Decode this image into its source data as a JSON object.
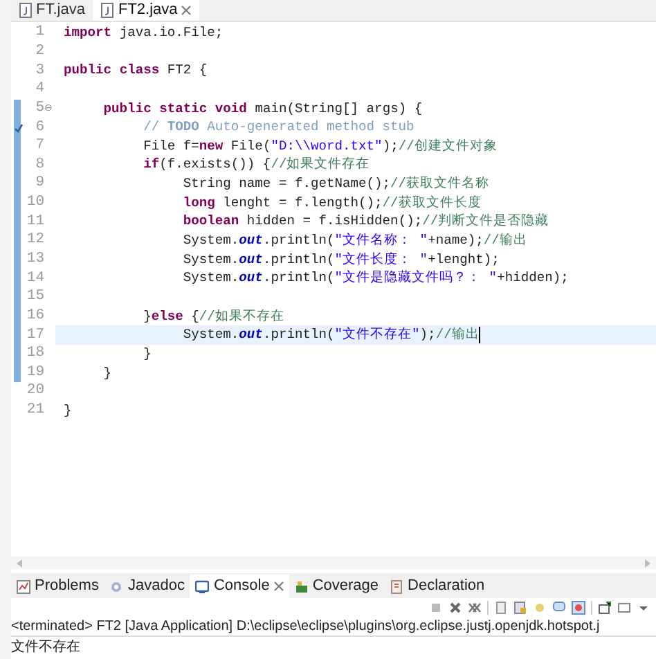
{
  "editor_tabs": [
    {
      "label": "FT.java",
      "selected": false
    },
    {
      "label": "FT2.java",
      "selected": true
    }
  ],
  "code_lines": [
    {
      "number": "1",
      "current": false,
      "tokens": [
        {
          "kind": "keyword",
          "text": "import "
        },
        {
          "kind": "plain",
          "text": "java.io.File;"
        }
      ]
    },
    {
      "number": "2",
      "current": false
    },
    {
      "number": "3",
      "current": false,
      "tokens": [
        {
          "kind": "keyword",
          "text": "public "
        },
        {
          "kind": "keyword",
          "text": "class "
        },
        {
          "kind": "plain",
          "text": "FT2 {"
        }
      ]
    },
    {
      "number": "4",
      "current": false
    },
    {
      "number": "5",
      "current": false,
      "fold": "⊖",
      "tokens": [
        {
          "kind": "keyword",
          "text": "     public "
        },
        {
          "kind": "keyword",
          "text": "static "
        },
        {
          "kind": "keyword",
          "text": "void "
        },
        {
          "kind": "plain",
          "text": "main(String[] args) {"
        }
      ]
    },
    {
      "number": "6",
      "current": false,
      "task_marker": true,
      "tokens": [
        {
          "kind": "javadoc",
          "text": "          // "
        },
        {
          "kind": "todo",
          "text": "TODO"
        },
        {
          "kind": "javadoc",
          "text": " Auto-generated method stub"
        }
      ]
    },
    {
      "number": "7",
      "current": false,
      "tokens": [
        {
          "kind": "plain",
          "text": "          File f="
        },
        {
          "kind": "keyword",
          "text": "new"
        },
        {
          "kind": "plain",
          "text": " File("
        },
        {
          "kind": "string",
          "text": "\"D:\\\\word.txt\""
        },
        {
          "kind": "plain",
          "text": ");"
        },
        {
          "kind": "comment",
          "text": "//创建文件对象"
        }
      ]
    },
    {
      "number": "8",
      "current": false,
      "tokens": [
        {
          "kind": "keyword",
          "text": "          if"
        },
        {
          "kind": "plain",
          "text": "(f.exists()) {"
        },
        {
          "kind": "comment",
          "text": "//如果文件存在"
        }
      ]
    },
    {
      "number": "9",
      "current": false,
      "tokens": [
        {
          "kind": "plain",
          "text": "               String name = f.getName();"
        },
        {
          "kind": "comment",
          "text": "//获取文件名称"
        }
      ]
    },
    {
      "number": "10",
      "current": false,
      "tokens": [
        {
          "kind": "keyword",
          "text": "               long"
        },
        {
          "kind": "plain",
          "text": " lenght = f.length();"
        },
        {
          "kind": "comment",
          "text": "//获取文件长度"
        }
      ]
    },
    {
      "number": "11",
      "current": false,
      "tokens": [
        {
          "kind": "keyword",
          "text": "               boolean"
        },
        {
          "kind": "plain",
          "text": " hidden = f.isHidden();"
        },
        {
          "kind": "comment",
          "text": "//判断文件是否隐藏"
        }
      ]
    },
    {
      "number": "12",
      "current": false,
      "tokens": [
        {
          "kind": "plain",
          "text": "               System."
        },
        {
          "kind": "field",
          "text": "out"
        },
        {
          "kind": "plain",
          "text": ".println("
        },
        {
          "kind": "string",
          "text": "\"文件名称： \""
        },
        {
          "kind": "plain",
          "text": "+name);"
        },
        {
          "kind": "comment",
          "text": "//输出"
        }
      ]
    },
    {
      "number": "13",
      "current": false,
      "tokens": [
        {
          "kind": "plain",
          "text": "               System."
        },
        {
          "kind": "field",
          "text": "out"
        },
        {
          "kind": "plain",
          "text": ".println("
        },
        {
          "kind": "string",
          "text": "\"文件长度： \""
        },
        {
          "kind": "plain",
          "text": "+lenght);"
        }
      ]
    },
    {
      "number": "14",
      "current": false,
      "tokens": [
        {
          "kind": "plain",
          "text": "               System."
        },
        {
          "kind": "field",
          "text": "out"
        },
        {
          "kind": "plain",
          "text": ".println("
        },
        {
          "kind": "string",
          "text": "\"文件是隐藏文件吗？： \""
        },
        {
          "kind": "plain",
          "text": "+hidden);"
        }
      ]
    },
    {
      "number": "15",
      "current": false
    },
    {
      "number": "16",
      "current": false,
      "tokens": [
        {
          "kind": "plain",
          "text": "          }"
        },
        {
          "kind": "keyword",
          "text": "else"
        },
        {
          "kind": "plain",
          "text": " {"
        },
        {
          "kind": "comment",
          "text": "//如果不存在"
        }
      ]
    },
    {
      "number": "17",
      "current": true,
      "tokens": [
        {
          "kind": "plain",
          "text": "               System."
        },
        {
          "kind": "field",
          "text": "out"
        },
        {
          "kind": "plain",
          "text": ".println("
        },
        {
          "kind": "string",
          "text": "\"文件不存在\""
        },
        {
          "kind": "plain",
          "text": ");"
        },
        {
          "kind": "comment",
          "text": "//输出"
        }
      ]
    },
    {
      "number": "18",
      "current": false,
      "tokens": [
        {
          "kind": "plain",
          "text": "          }"
        }
      ]
    },
    {
      "number": "19",
      "current": false,
      "tokens": [
        {
          "kind": "plain",
          "text": "     }"
        }
      ]
    },
    {
      "number": "20",
      "current": false
    },
    {
      "number": "21",
      "current": false,
      "tokens": [
        {
          "kind": "plain",
          "text": "}"
        }
      ]
    }
  ],
  "panel_tabs": [
    {
      "label": "Problems",
      "selected": false
    },
    {
      "label": "Javadoc",
      "selected": false
    },
    {
      "label": "Console",
      "selected": true
    },
    {
      "label": "Coverage",
      "selected": false
    },
    {
      "label": "Declaration",
      "selected": false
    }
  ],
  "console": {
    "header": "<terminated> FT2 [Java Application] D:\\eclipse\\eclipse\\plugins\\org.eclipse.justj.openjdk.hotspot.j",
    "output": "文件不存在"
  }
}
